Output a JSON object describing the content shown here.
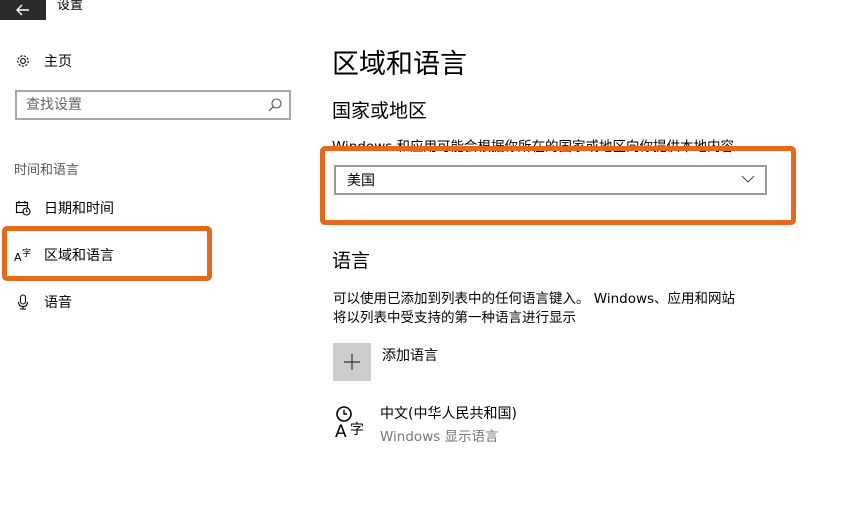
{
  "window": {
    "title": "设置"
  },
  "sidebar": {
    "home_label": "主页",
    "search_placeholder": "查找设置",
    "section_label": "时间和语言",
    "items": [
      {
        "label": "日期和时间",
        "icon": "calendar-clock-icon"
      },
      {
        "label": "区域和语言",
        "icon": "region-language-icon",
        "selected": true
      },
      {
        "label": "语音",
        "icon": "microphone-icon"
      }
    ]
  },
  "main": {
    "title": "区域和语言",
    "country": {
      "heading": "国家或地区",
      "description": "Windows 和应用可能会根据你所在的国家或地区向你提供本地内容",
      "selected": "美国"
    },
    "language": {
      "heading": "语言",
      "description_line1": "可以使用已添加到列表中的任何语言键入。 Windows、应用和网站",
      "description_line2": "将以列表中受支持的第一种语言进行显示",
      "add_label": "添加语言",
      "entries": [
        {
          "name": "中文(中华人民共和国)",
          "sub": "Windows 显示语言"
        }
      ]
    }
  },
  "colors": {
    "highlight": "#e4691c",
    "titlebar": "#2b2b2b",
    "add_button": "#cccccc"
  }
}
